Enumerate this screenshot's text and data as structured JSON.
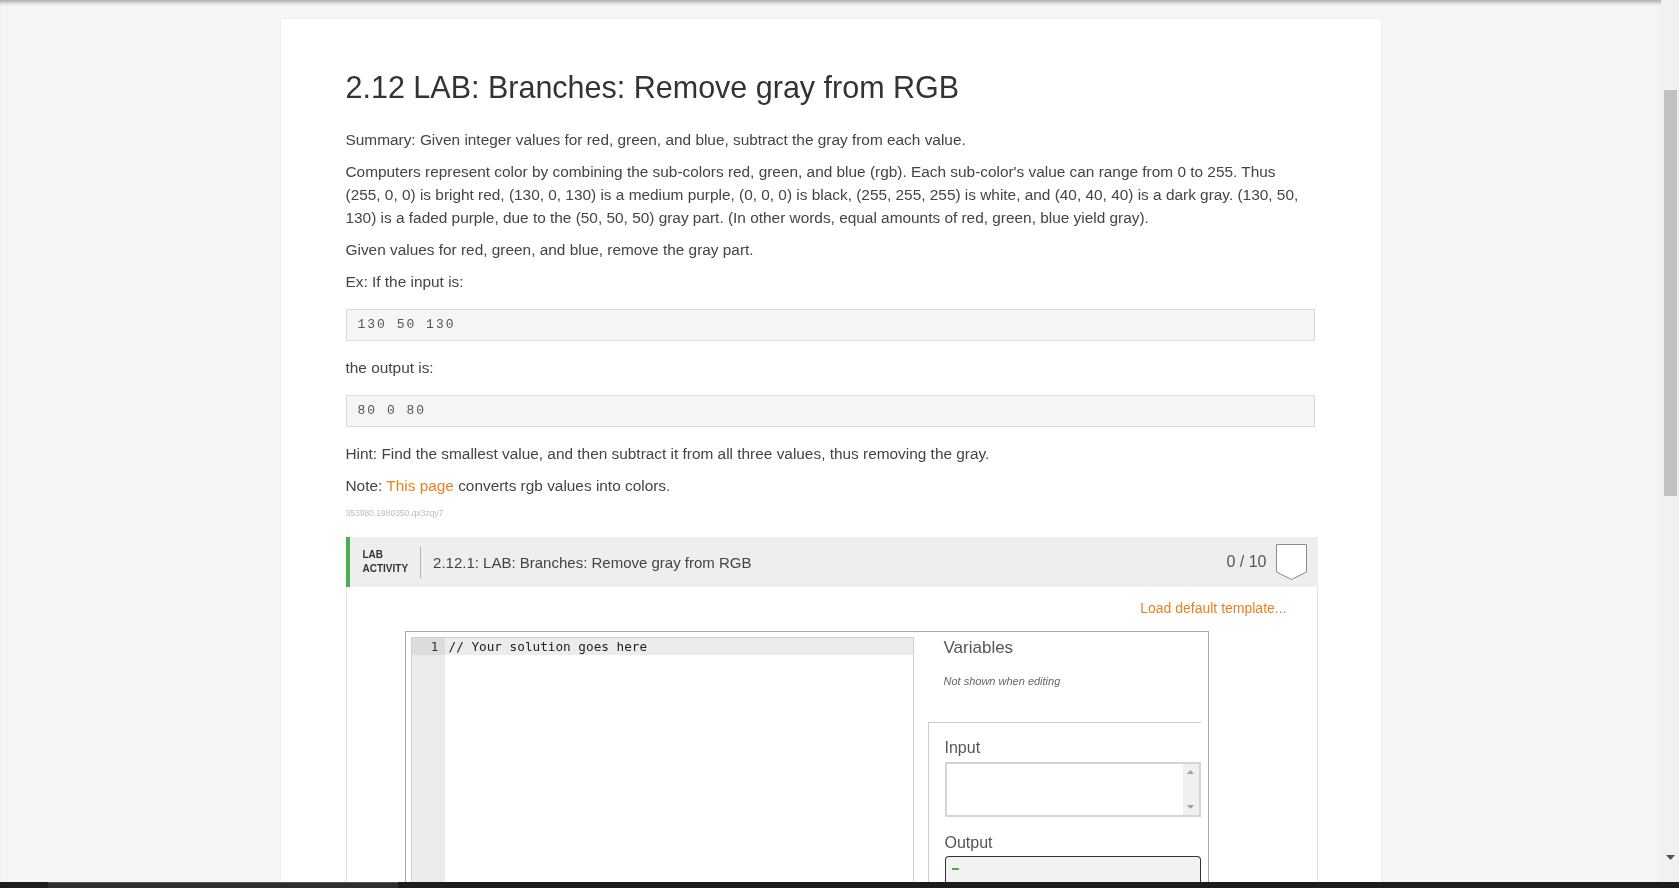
{
  "page": {
    "title": "2.12 LAB: Branches: Remove gray from RGB",
    "content": [
      {
        "kind": "paragraph",
        "text": "Summary: Given integer values for red, green, and blue, subtract the gray from each value."
      },
      {
        "kind": "paragraph",
        "text": "Computers represent color by combining the sub-colors red, green, and blue (rgb). Each sub-color's value can range from 0 to 255. Thus (255, 0, 0) is bright red, (130, 0, 130) is a medium purple, (0, 0, 0) is black, (255, 255, 255) is white, and (40, 40, 40) is a dark gray. (130, 50, 130) is a faded purple, due to the (50, 50, 50) gray part. (In other words, equal amounts of red, green, blue yield gray)."
      },
      {
        "kind": "paragraph",
        "text": "Given values for red, green, and blue, remove the gray part."
      },
      {
        "kind": "paragraph",
        "text": "Ex: If the input is:"
      },
      {
        "kind": "code",
        "text": "130 50 130"
      },
      {
        "kind": "paragraph",
        "text": "the output is:"
      },
      {
        "kind": "code",
        "text": "80 0 80"
      },
      {
        "kind": "paragraph",
        "text": "Hint: Find the smallest value, and then subtract it from all three values, thus removing the gray."
      },
      {
        "kind": "link_paragraph",
        "before": "Note: ",
        "link": "This page",
        "after": " converts rgb values into colors."
      },
      {
        "kind": "id",
        "text": "353980.1980350.qx3zqy7"
      }
    ]
  },
  "lab": {
    "type_label": "LAB ACTIVITY",
    "title": "2.12.1: LAB: Branches: Remove gray from RGB",
    "score": "0 / 10",
    "load_template": "Load default template...",
    "editor": {
      "lines": [
        {
          "number": "1",
          "code": "// Your solution goes here",
          "current": true
        }
      ]
    },
    "variables": {
      "heading": "Variables",
      "note": "Not shown when editing"
    },
    "input": {
      "label": "Input"
    },
    "output": {
      "label": "Output"
    }
  }
}
